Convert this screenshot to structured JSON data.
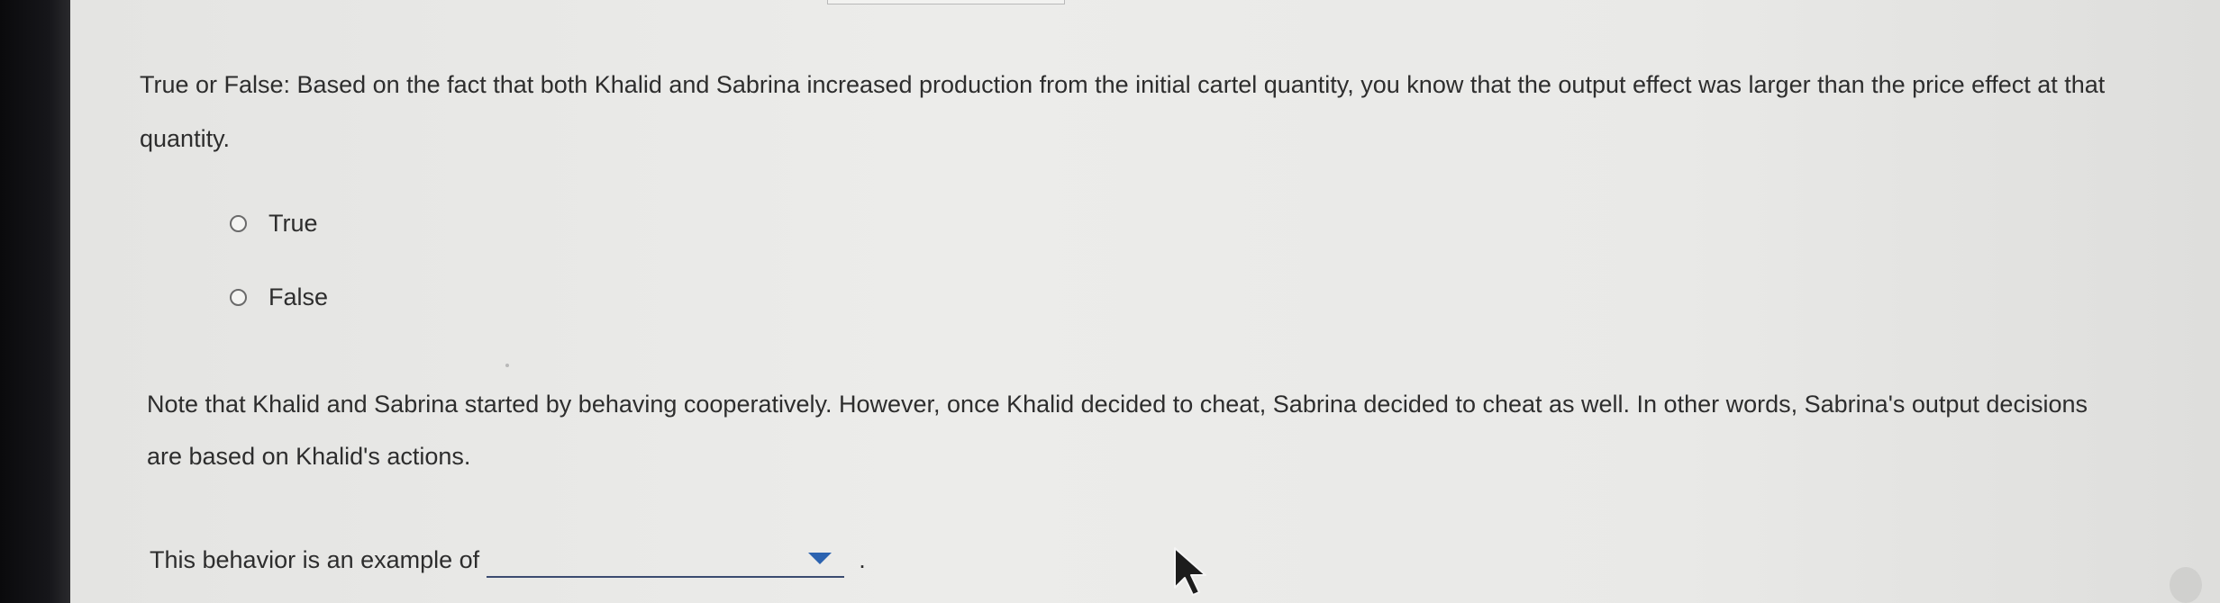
{
  "question": {
    "text": "True or False: Based on the fact that both Khalid and Sabrina increased production from the initial cartel quantity, you know that the output effect was larger than the price effect at that quantity.",
    "options": [
      {
        "label": "True"
      },
      {
        "label": "False"
      }
    ]
  },
  "note": {
    "text": "Note that Khalid and Sabrina started by behaving cooperatively. However, once Khalid decided to cheat, Sabrina decided to cheat as well. In other words, Sabrina's output decisions are based on Khalid's actions."
  },
  "behavior": {
    "label": "This behavior is an example of",
    "dropdown_value": "",
    "period": "."
  },
  "icons": {
    "radio": "radio-button-icon",
    "dropdown_caret": "caret-down-icon",
    "cursor": "mouse-pointer-icon"
  },
  "colors": {
    "dropdown_caret": "#2c63b0",
    "dropdown_underline": "#3b4b70"
  }
}
